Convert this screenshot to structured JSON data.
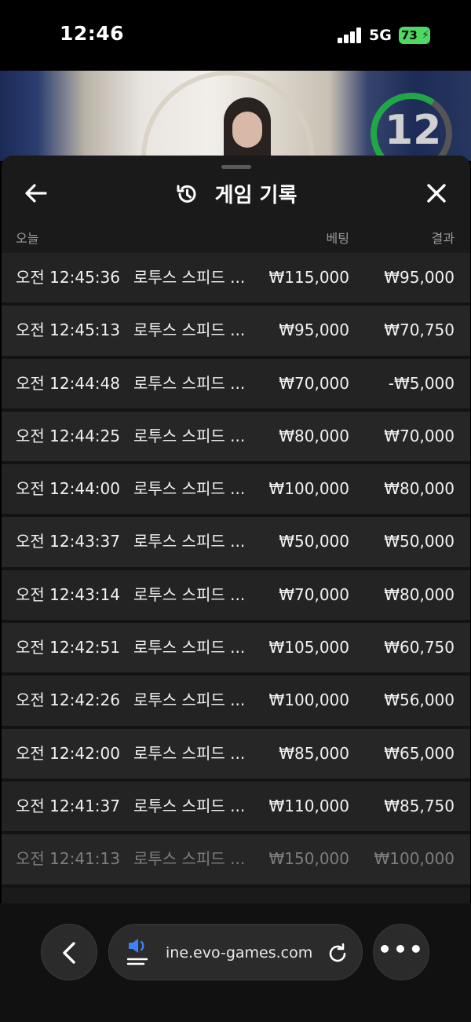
{
  "status": {
    "time": "12:46",
    "network": "5G",
    "battery": "73"
  },
  "game": {
    "timer": "12"
  },
  "header": {
    "title": "게임 기록"
  },
  "columns": {
    "today": "오늘",
    "bet": "베팅",
    "result": "결과"
  },
  "rows": [
    {
      "time": "오전 12:45:36",
      "game": "로투스 스피드 ...",
      "bet": "₩115,000",
      "result": "₩95,000"
    },
    {
      "time": "오전 12:45:13",
      "game": "로투스 스피드 ...",
      "bet": "₩95,000",
      "result": "₩70,750"
    },
    {
      "time": "오전 12:44:48",
      "game": "로투스 스피드 ...",
      "bet": "₩70,000",
      "result": "-₩5,000"
    },
    {
      "time": "오전 12:44:25",
      "game": "로투스 스피드 ...",
      "bet": "₩80,000",
      "result": "₩70,000"
    },
    {
      "time": "오전 12:44:00",
      "game": "로투스 스피드 ...",
      "bet": "₩100,000",
      "result": "₩80,000"
    },
    {
      "time": "오전 12:43:37",
      "game": "로투스 스피드 ...",
      "bet": "₩50,000",
      "result": "₩50,000"
    },
    {
      "time": "오전 12:43:14",
      "game": "로투스 스피드 ...",
      "bet": "₩70,000",
      "result": "₩80,000"
    },
    {
      "time": "오전 12:42:51",
      "game": "로투스 스피드 ...",
      "bet": "₩105,000",
      "result": "₩60,750"
    },
    {
      "time": "오전 12:42:26",
      "game": "로투스 스피드 ...",
      "bet": "₩100,000",
      "result": "₩56,000"
    },
    {
      "time": "오전 12:42:00",
      "game": "로투스 스피드 ...",
      "bet": "₩85,000",
      "result": "₩65,000"
    },
    {
      "time": "오전 12:41:37",
      "game": "로투스 스피드 ...",
      "bet": "₩110,000",
      "result": "₩85,750"
    },
    {
      "time": "오전 12:41:13",
      "game": "로투스 스피드 ...",
      "bet": "₩150,000",
      "result": "₩100,000"
    }
  ],
  "browser": {
    "url": "ine.evo-games.com",
    "more": "•••"
  },
  "icons": {
    "back": "arrow-left-icon",
    "history": "history-icon",
    "close": "close-icon",
    "nav_back": "chevron-left-icon",
    "sound": "speaker-icon",
    "reload": "reload-icon",
    "more": "more-icon"
  },
  "colors": {
    "battery": "#4cd964",
    "timer_ring": "#1fa845",
    "sheet_bg": "#1a1a1a"
  }
}
